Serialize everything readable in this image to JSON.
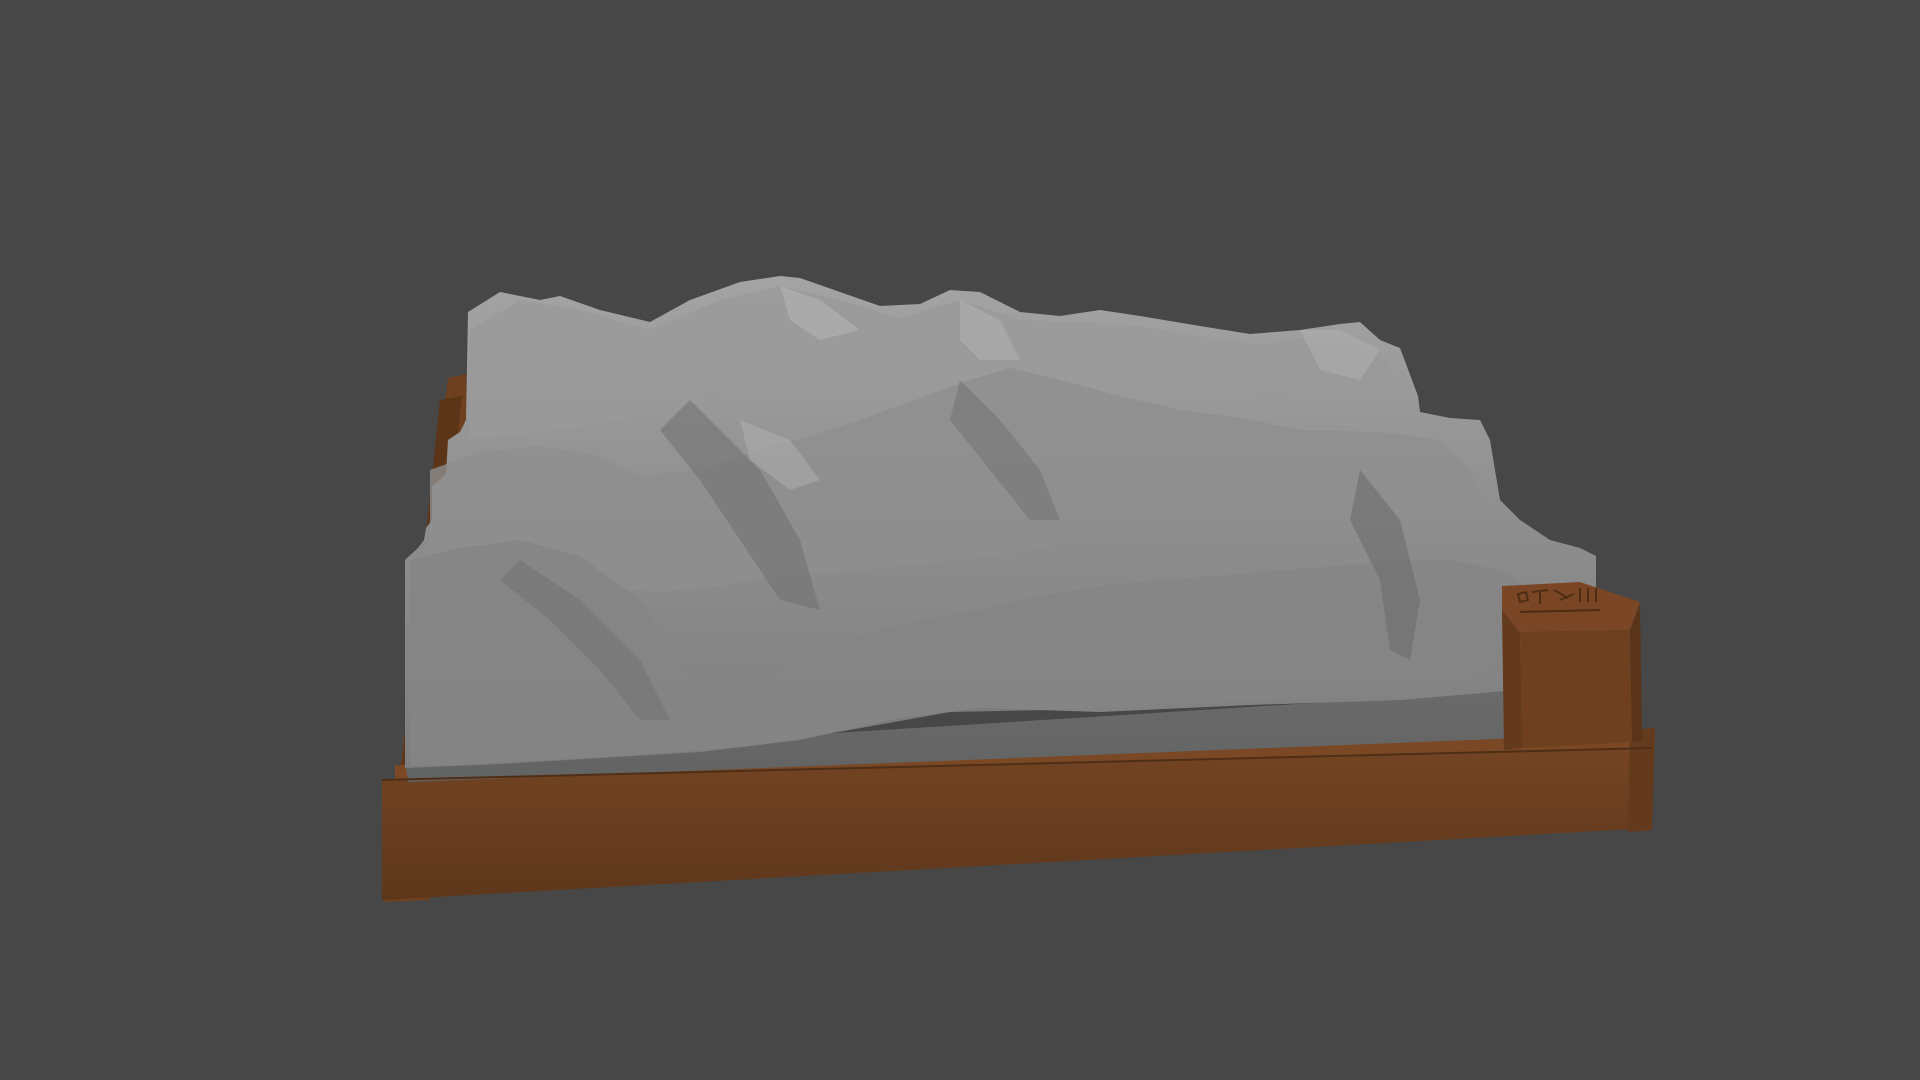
{
  "viewport": {
    "background_color": "#474747",
    "object": "terrain-relief-model"
  },
  "model": {
    "terrain_color": "#8c8c8c",
    "terrain_side_color": "#666767",
    "base_color": "#6e4020",
    "base_side_color": "#5a3418",
    "tag_text": ""
  }
}
